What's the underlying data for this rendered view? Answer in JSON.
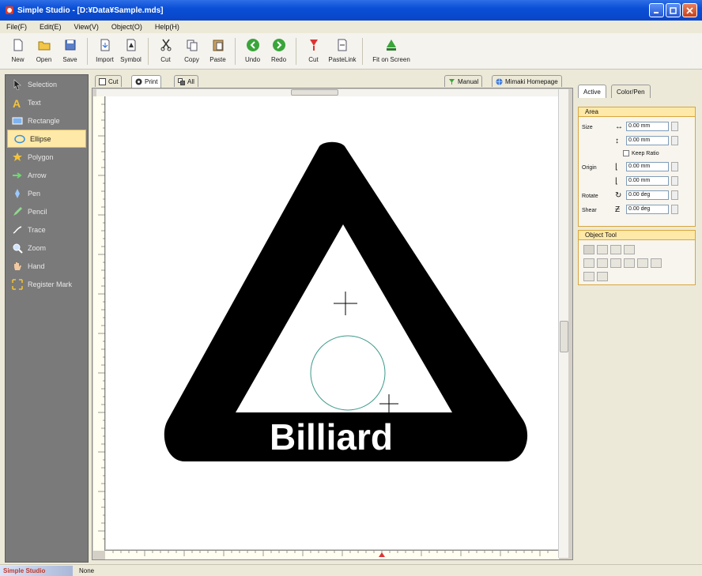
{
  "window": {
    "title": "Simple Studio - [D:¥Data¥Sample.mds]"
  },
  "menu": [
    "File(F)",
    "Edit(E)",
    "View(V)",
    "Object(O)",
    "Help(H)"
  ],
  "toolbar": [
    {
      "label": "New",
      "icon": "new-file-icon"
    },
    {
      "label": "Open",
      "icon": "folder-open-icon"
    },
    {
      "label": "Save",
      "icon": "save-icon"
    },
    {
      "label": "Import",
      "icon": "import-icon"
    },
    {
      "label": "Symbol",
      "icon": "symbol-icon"
    },
    {
      "label": "Cut",
      "icon": "scissors-icon"
    },
    {
      "label": "Copy",
      "icon": "copy-icon"
    },
    {
      "label": "Paste",
      "icon": "paste-icon"
    },
    {
      "label": "Undo",
      "icon": "undo-icon"
    },
    {
      "label": "Redo",
      "icon": "redo-icon"
    },
    {
      "label": "Cut",
      "icon": "cut-plot-icon"
    },
    {
      "label": "PasteLink",
      "icon": "paste-link-icon"
    },
    {
      "label": "Fit on Screen",
      "icon": "fit-screen-icon"
    }
  ],
  "tools": [
    {
      "label": "Selection",
      "icon": "arrow-cursor-icon",
      "active": false
    },
    {
      "label": "Text",
      "icon": "text-icon",
      "active": false
    },
    {
      "label": "Rectangle",
      "icon": "rectangle-icon",
      "active": false
    },
    {
      "label": "Ellipse",
      "icon": "ellipse-icon",
      "active": true
    },
    {
      "label": "Polygon",
      "icon": "star-icon",
      "active": false
    },
    {
      "label": "Arrow",
      "icon": "arrow-icon",
      "active": false
    },
    {
      "label": "Pen",
      "icon": "pen-icon",
      "active": false
    },
    {
      "label": "Pencil",
      "icon": "pencil-icon",
      "active": false
    },
    {
      "label": "Trace",
      "icon": "trace-icon",
      "active": false
    },
    {
      "label": "Zoom",
      "icon": "zoom-icon",
      "active": false
    },
    {
      "label": "Hand",
      "icon": "hand-icon",
      "active": false
    },
    {
      "label": "Register Mark",
      "icon": "register-mark-icon",
      "active": false
    }
  ],
  "doc_tabs": [
    {
      "label": "Cut",
      "active": false
    },
    {
      "label": "Print",
      "active": true
    },
    {
      "label": "All",
      "active": false
    }
  ],
  "help_tabs": [
    {
      "label": "Manual"
    },
    {
      "label": "Mimaki Homepage"
    }
  ],
  "canvas": {
    "text": "Billiard"
  },
  "right_panel": {
    "tabs": [
      "Active",
      "Color/Pen"
    ],
    "area": {
      "title": "Area",
      "size_label": "Size",
      "width_value": "0.00 mm",
      "height_value": "0.00 mm",
      "keep_ratio": "Keep Ratio",
      "origin_label": "Origin",
      "origin_x": "0.00 mm",
      "origin_y": "0.00 mm",
      "rotate_label": "Rotate",
      "rotate_value": "0.00 deg",
      "shear_label": "Shear",
      "shear_value": "0.00 deg"
    },
    "object_tool": {
      "title": "Object Tool"
    }
  },
  "status": {
    "app": "Simple Studio",
    "state": "None"
  },
  "colors": {
    "accent": "#0a4fd6",
    "selected_tool": "#ffe9a8",
    "tool_panel": "#7a7a7a"
  }
}
